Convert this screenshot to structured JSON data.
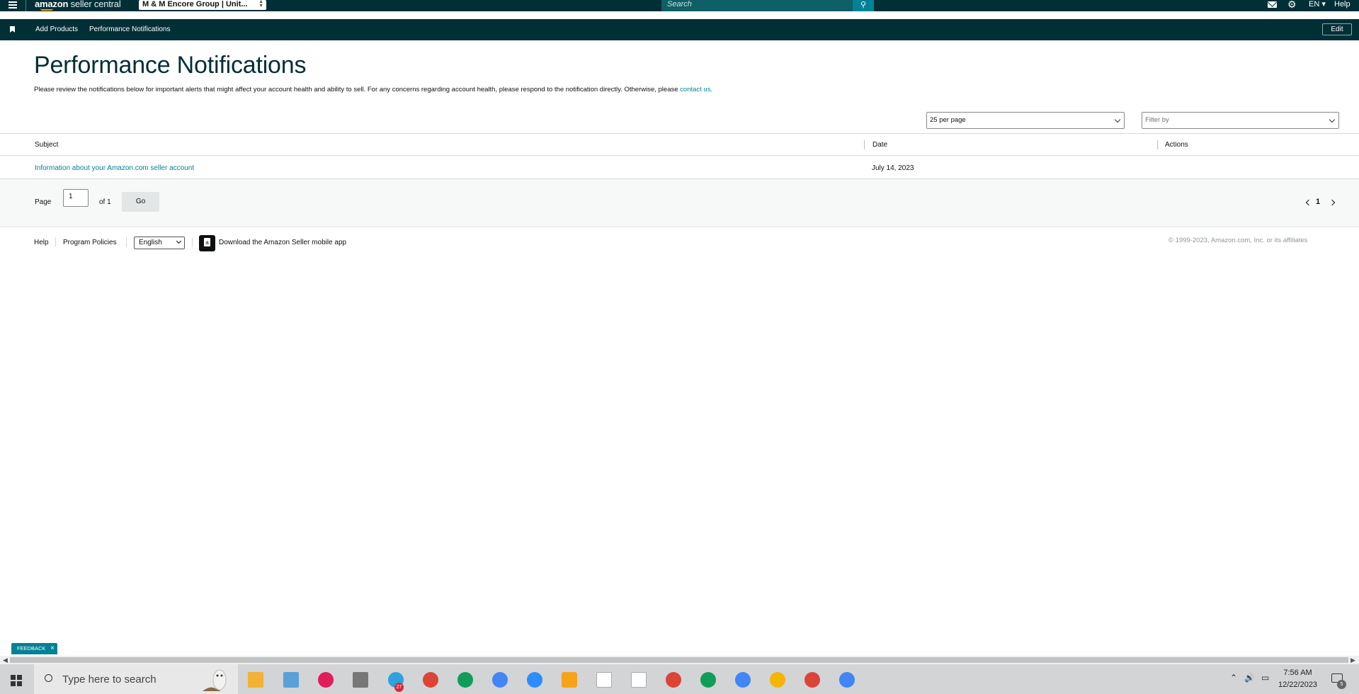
{
  "topbar": {
    "logo_main": "amazon",
    "logo_sub": "seller central",
    "account": "M & M Encore Group | Unit...",
    "search_placeholder": "Search",
    "language": "EN",
    "help": "Help"
  },
  "subbar": {
    "links": [
      "Add Products",
      "Performance Notifications"
    ],
    "edit": "Edit"
  },
  "main": {
    "title": "Performance Notifications",
    "intro": "Please review the notifications below for important alerts that might affect your account health and ability to sell. For any concerns regarding account health, please respond to the notification directly. Otherwise, please ",
    "intro_link": "contact us",
    "intro_end": ".",
    "per_page": "25 per page",
    "filter_placeholder": "Filter by"
  },
  "table": {
    "headers": [
      "Subject",
      "Date",
      "Actions"
    ],
    "rows": [
      {
        "subject": "Information about your Amazon.com seller account",
        "date": "July 14, 2023",
        "actions": ""
      }
    ]
  },
  "pager": {
    "page_label": "Page",
    "page_value": "1",
    "of_label": "of 1",
    "go": "Go",
    "current": "1"
  },
  "footer": {
    "help": "Help",
    "policies": "Program Policies",
    "language": "English",
    "app_text": "Download the Amazon Seller mobile app",
    "copyright": "© 1999-2023, Amazon.com, Inc. or its affiliates"
  },
  "feedback": "FEEDBACK",
  "taskbar": {
    "search_placeholder": "Type here to search",
    "time": "7:56 AM",
    "date": "12/22/2023",
    "telegram_badge": "27",
    "notif_count": "5"
  }
}
